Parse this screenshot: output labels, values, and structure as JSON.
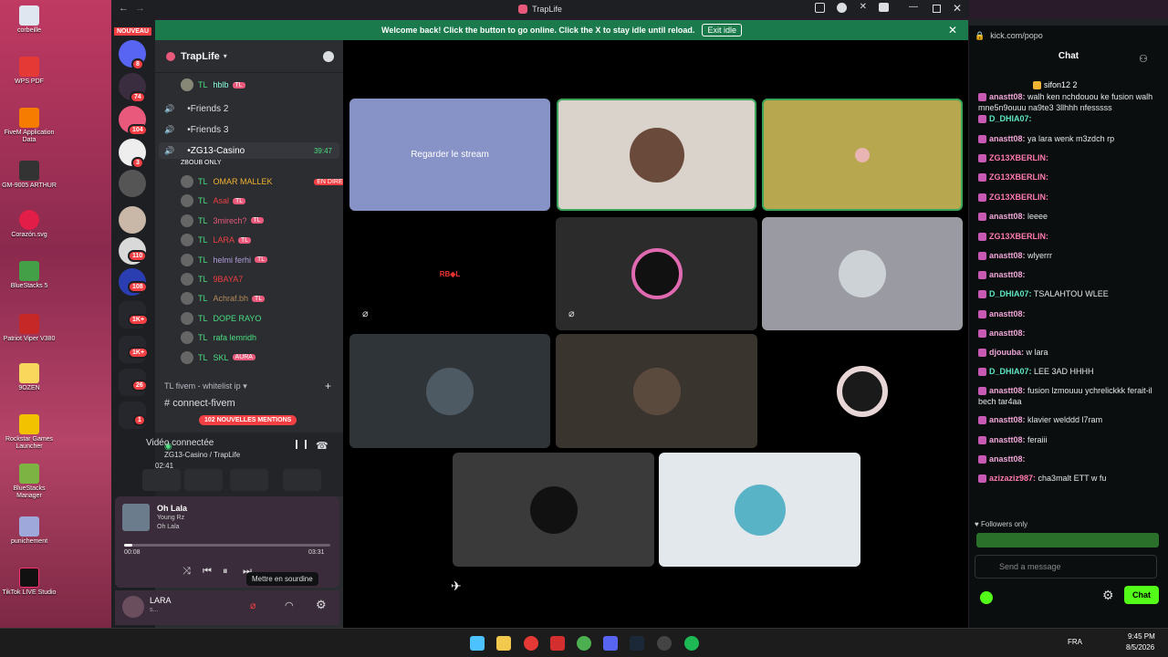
{
  "window": {
    "title": "TrapLife"
  },
  "banner": {
    "text": "Welcome back! Click the button to go online. Click the X to stay idle until reload.",
    "button": "Exit idle"
  },
  "rail": {
    "top_badge": "NOUVEAU",
    "badges": [
      "8",
      "74",
      "104",
      "3",
      "110",
      "108",
      "1K+",
      "1K+",
      "26",
      "1"
    ]
  },
  "server": {
    "name": "TrapLife"
  },
  "channels": {
    "top_member": {
      "name": "hblb",
      "tag": "TL"
    },
    "voice": [
      {
        "name": "Friends 2"
      },
      {
        "name": "Friends 3"
      },
      {
        "name": "ZG13-Casino",
        "time": "39:47",
        "note": "ZBOUB ONLY"
      }
    ],
    "members": [
      {
        "name": "OMAR MALLEK",
        "badge": "EN DIRECT",
        "color": "#f0b232"
      },
      {
        "name": "Asal",
        "tag": "TL",
        "color": "#f23f43"
      },
      {
        "name": "3mirech?",
        "tag": "TL",
        "color": "#e8597b"
      },
      {
        "name": "LARA",
        "tag": "TL",
        "color": "#f23f43"
      },
      {
        "name": "helmi ferhi",
        "tag": "TL",
        "color": "#b39ddb"
      },
      {
        "name": "9BAYA7",
        "tag": "",
        "color": "#f23f43"
      },
      {
        "name": "Achraf.bh",
        "tag": "TL",
        "color": "#b48a5a"
      },
      {
        "name": "DOPE RAYO",
        "tag": "",
        "color": "#4ade80"
      },
      {
        "name": "rafa lemridh",
        "tag": "",
        "color": "#4ade80"
      },
      {
        "name": "SKL",
        "tag": "AURA",
        "color": "#4ade80"
      }
    ],
    "category": "TL fivem - whitelist ip",
    "text_channel": "connect-fivem",
    "mentions": "102 NOUVELLES MENTIONS"
  },
  "voice_panel": {
    "status": "Vidéo connectée",
    "channel": "ZG13-Casino / TrapLife",
    "elapsed": "02:41"
  },
  "music": {
    "title": "Oh Lala",
    "artist": "Young Rz",
    "album": "Oh Lala",
    "current": "00:08",
    "total": "03:31",
    "progress": 0.04
  },
  "tooltip": "Mettre en sourdine",
  "user": {
    "name": "LARA",
    "status": "s..."
  },
  "stage": {
    "stream_label": "Regarder le stream"
  },
  "chat": {
    "url": "kick.com/popo",
    "title": "Chat",
    "pinned_user": "sifon12",
    "pinned_count": "2",
    "messages": [
      {
        "user": "anastt08:",
        "text": "walh ken nchdouou ke fusion walh mne5n9ouuu na9te3 3llhhh nfesssss",
        "cls": "u"
      },
      {
        "user": "D_DHIA07:",
        "text": "",
        "cls": "ub"
      },
      {
        "user": "anastt08:",
        "text": "ya lara wenk m3zdch rp",
        "cls": "u"
      },
      {
        "user": "ZG13XBERLIN:",
        "text": "",
        "cls": "ur"
      },
      {
        "user": "ZG13XBERLIN:",
        "text": "",
        "cls": "ur"
      },
      {
        "user": "ZG13XBERLIN:",
        "text": "",
        "cls": "ur"
      },
      {
        "user": "anastt08:",
        "text": "leeee",
        "cls": "u"
      },
      {
        "user": "ZG13XBERLIN:",
        "text": "",
        "cls": "ur"
      },
      {
        "user": "anastt08:",
        "text": "wlyerrr",
        "cls": "u"
      },
      {
        "user": "anastt08:",
        "text": "",
        "cls": "u"
      },
      {
        "user": "D_DHIA07:",
        "text": "TSALAHTOU WLEE",
        "cls": "ub"
      },
      {
        "user": "anastt08:",
        "text": "",
        "cls": "u"
      },
      {
        "user": "anastt08:",
        "text": "",
        "cls": "u"
      },
      {
        "user": "djouuba:",
        "text": "w lara",
        "cls": "u"
      },
      {
        "user": "D_DHIA07:",
        "text": "LEE 3AD HHHH",
        "cls": "ub"
      },
      {
        "user": "anastt08:",
        "text": "fusion lzmouuu ychrelickkk ferait-il bech tar4aa",
        "cls": "u"
      },
      {
        "user": "anastt08:",
        "text": "klavier welddd l7ram",
        "cls": "u"
      },
      {
        "user": "anastt08:",
        "text": "feraiii",
        "cls": "u"
      },
      {
        "user": "anastt08:",
        "text": "",
        "cls": "u"
      },
      {
        "user": "azizaziz987:",
        "text": "cha3malt ETT w fu",
        "cls": "ur"
      }
    ],
    "followers_only": "Followers only",
    "placeholder": "Send a message",
    "chat_button": "Chat"
  },
  "taskbar": {
    "lang": "FRA",
    "time": "9:45 PM",
    "date": "8/5/2026"
  },
  "desktop": {
    "icons": [
      "corbeille",
      "WPS PDF",
      "FiveM Application Data",
      "GM-9005 ARTHUR",
      "Corazón.svg",
      "BlueStacks 5",
      "Patriot Viper V380",
      "9OZEN",
      "Rockstar Games Launcher",
      "BlueStacks Manager",
      "punichement",
      "TikTok LIVE Studio"
    ]
  }
}
